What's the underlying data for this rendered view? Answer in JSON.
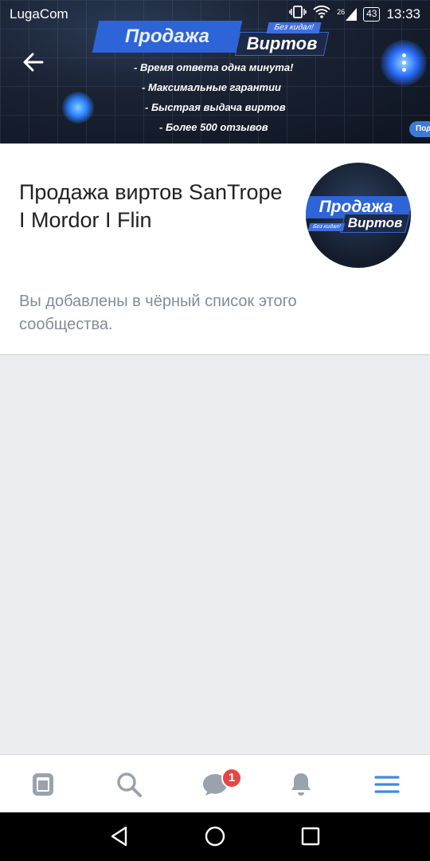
{
  "status_bar": {
    "carrier": "LugaCom",
    "network": "26",
    "battery": "43",
    "time": "13:33"
  },
  "cover": {
    "title_main": "Продажа",
    "title_secondary": "Виртов",
    "tag": "Без кидал!",
    "lines": [
      "Время ответа одна минута!",
      "Максимальные гарантии",
      "Быстрая выдача виртов",
      "Более 500 отзывов"
    ],
    "bubble": "Под"
  },
  "header": {
    "back_icon": "arrow-left-icon",
    "more_icon": "more-vertical-icon"
  },
  "group": {
    "name": "Продажа виртов SanTrope I Mordor I Flin",
    "avatar_main": "Продажа",
    "avatar_secondary": "Виртов",
    "avatar_tag": "Без кидал!",
    "message": "Вы добавлены в чёрный список этого сообщества."
  },
  "tabbar": {
    "items": [
      {
        "icon": "news-icon"
      },
      {
        "icon": "search-icon"
      },
      {
        "icon": "messages-icon",
        "badge": "1"
      },
      {
        "icon": "notifications-icon"
      },
      {
        "icon": "menu-icon",
        "active": true
      }
    ],
    "color_inactive": "#99a2ad",
    "color_active": "#3f8ae0",
    "badge_color": "#e64646"
  },
  "system_nav": {
    "icons": [
      "back-triangle-icon",
      "home-circle-icon",
      "recents-square-icon"
    ]
  }
}
